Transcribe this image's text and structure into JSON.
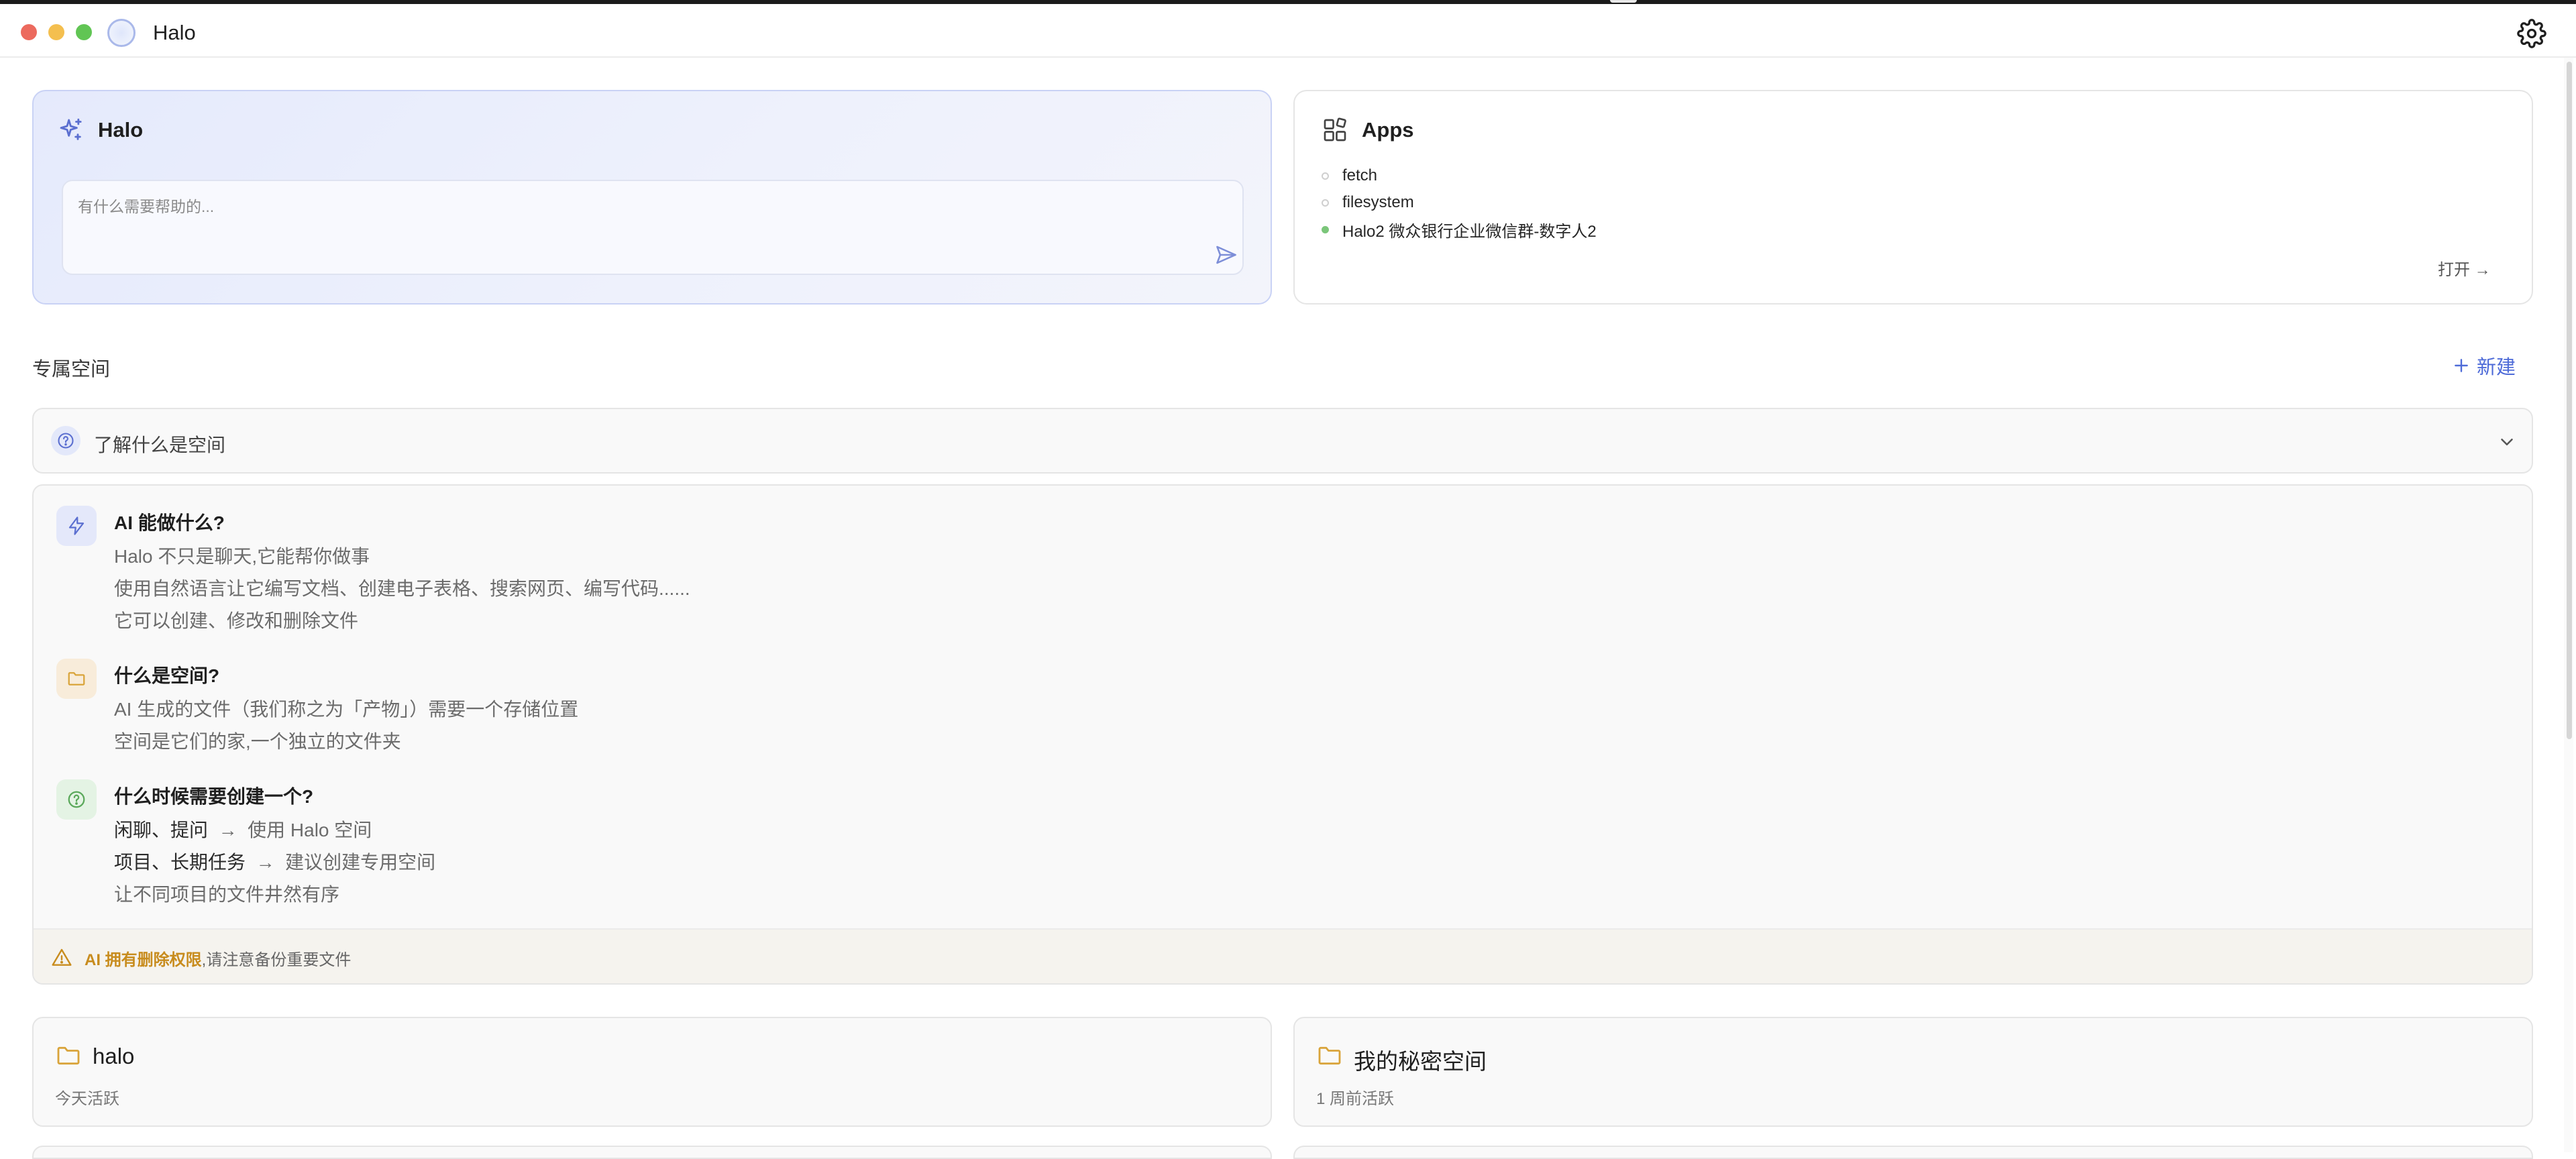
{
  "window": {
    "title": "Halo"
  },
  "halo_card": {
    "title": "Halo",
    "input_placeholder": "有什么需要帮助的..."
  },
  "apps_card": {
    "title": "Apps",
    "items": [
      {
        "label": "fetch",
        "active": false
      },
      {
        "label": "filesystem",
        "active": false
      },
      {
        "label": "Halo2 微众银行企业微信群-数字人2",
        "active": true
      }
    ],
    "open_label": "打开 →"
  },
  "spaces_section": {
    "title": "专属空间",
    "new_label": "新建"
  },
  "accordion": {
    "label": "了解什么是空间"
  },
  "info": {
    "block1": {
      "title": "AI 能做什么?",
      "lines": [
        "Halo 不只是聊天,它能帮你做事",
        "使用自然语言让它编写文档、创建电子表格、搜索网页、编写代码......",
        "它可以创建、修改和删除文件"
      ]
    },
    "block2": {
      "title": "什么是空间?",
      "lines": [
        "AI 生成的文件（我们称之为「产物」）需要一个存储位置",
        "空间是它们的家,一个独立的文件夹"
      ]
    },
    "block3": {
      "title": "什么时候需要创建一个?",
      "line1_strong": "闲聊、提问",
      "line1_arrow": "→",
      "line1_rest": "使用 Halo 空间",
      "line2_strong": "项目、长期任务",
      "line2_arrow": "→",
      "line2_rest": "建议创建专用空间",
      "line3": "让不同项目的文件井然有序"
    },
    "warning_strong": "AI 拥有删除权限",
    "warning_rest": ",请注意备份重要文件"
  },
  "spaces": [
    {
      "name": "halo",
      "activity": "今天活跃"
    },
    {
      "name": "我的秘密空间",
      "activity": "1 周前活跃"
    }
  ],
  "colors": {
    "accent": "#4e6bd8",
    "warning": "#c88c1e",
    "folder": "#d9a43a",
    "active_dot": "#7bc67a"
  }
}
